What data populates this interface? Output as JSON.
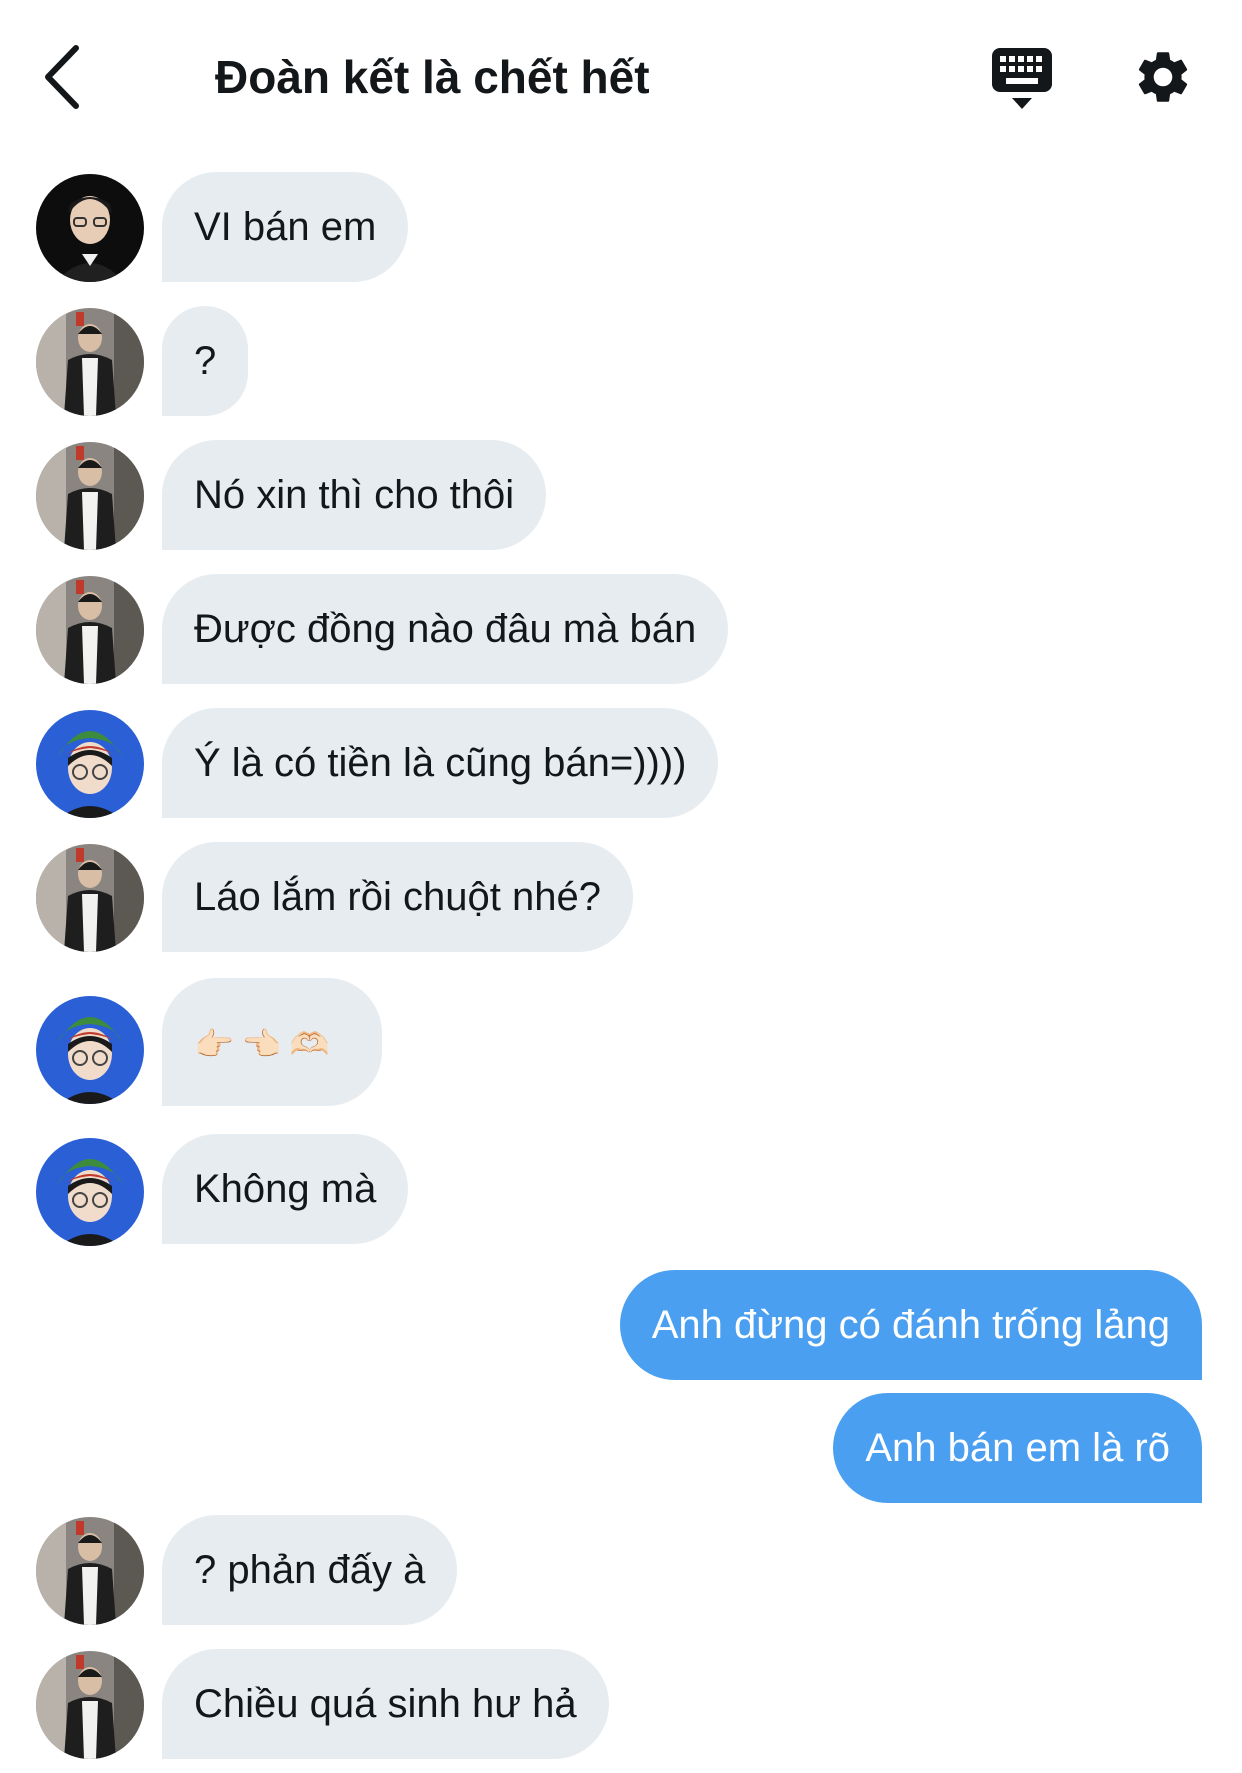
{
  "header": {
    "title": "Đoàn kết là chết hết"
  },
  "icons": {
    "back": "chevron-left-icon",
    "keyboard": "keyboard-icon",
    "settings": "gear-icon"
  },
  "messages": [
    {
      "from": "user-a",
      "text": "VI bán em"
    },
    {
      "from": "user-b",
      "text": "?"
    },
    {
      "from": "user-b",
      "text": "Nó xin thì cho thôi"
    },
    {
      "from": "user-b",
      "text": "Được đồng nào đâu mà bán"
    },
    {
      "from": "user-c",
      "text": "Ý là có tiền là cũng bán=))))"
    },
    {
      "from": "user-b",
      "text": "Láo lắm rồi chuột nhé?"
    },
    {
      "from": "user-c",
      "text": "👉🏻👈🏻🫶🏻"
    },
    {
      "from": "user-c",
      "text": "Không mà"
    },
    {
      "from": "me",
      "text": "Anh đừng có đánh trống lảng"
    },
    {
      "from": "me",
      "text": "Anh bán em là rõ"
    },
    {
      "from": "user-b",
      "text": "? phản đấy à"
    },
    {
      "from": "user-b",
      "text": "Chiều quá sinh hư hả"
    }
  ],
  "colors": {
    "incoming_bubble": "#e6ecf0",
    "outgoing_bubble": "#4a9ff0",
    "text": "#14171a"
  }
}
